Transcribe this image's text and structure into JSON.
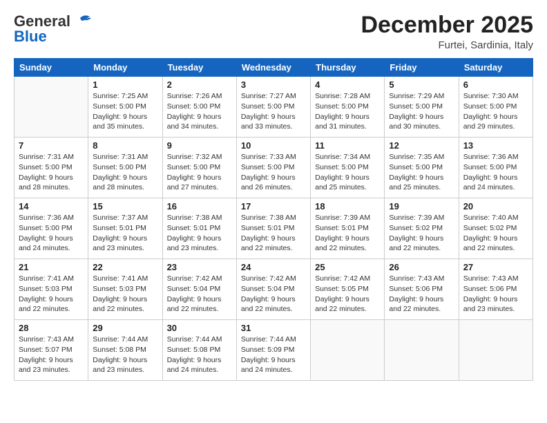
{
  "header": {
    "logo_general": "General",
    "logo_blue": "Blue",
    "month": "December 2025",
    "location": "Furtei, Sardinia, Italy"
  },
  "days_of_week": [
    "Sunday",
    "Monday",
    "Tuesday",
    "Wednesday",
    "Thursday",
    "Friday",
    "Saturday"
  ],
  "weeks": [
    [
      {
        "day": "",
        "sunrise": "",
        "sunset": "",
        "daylight": ""
      },
      {
        "day": "1",
        "sunrise": "7:25 AM",
        "sunset": "5:00 PM",
        "daylight": "9 hours and 35 minutes."
      },
      {
        "day": "2",
        "sunrise": "7:26 AM",
        "sunset": "5:00 PM",
        "daylight": "9 hours and 34 minutes."
      },
      {
        "day": "3",
        "sunrise": "7:27 AM",
        "sunset": "5:00 PM",
        "daylight": "9 hours and 33 minutes."
      },
      {
        "day": "4",
        "sunrise": "7:28 AM",
        "sunset": "5:00 PM",
        "daylight": "9 hours and 31 minutes."
      },
      {
        "day": "5",
        "sunrise": "7:29 AM",
        "sunset": "5:00 PM",
        "daylight": "9 hours and 30 minutes."
      },
      {
        "day": "6",
        "sunrise": "7:30 AM",
        "sunset": "5:00 PM",
        "daylight": "9 hours and 29 minutes."
      }
    ],
    [
      {
        "day": "7",
        "sunrise": "7:31 AM",
        "sunset": "5:00 PM",
        "daylight": "9 hours and 28 minutes."
      },
      {
        "day": "8",
        "sunrise": "7:31 AM",
        "sunset": "5:00 PM",
        "daylight": "9 hours and 28 minutes."
      },
      {
        "day": "9",
        "sunrise": "7:32 AM",
        "sunset": "5:00 PM",
        "daylight": "9 hours and 27 minutes."
      },
      {
        "day": "10",
        "sunrise": "7:33 AM",
        "sunset": "5:00 PM",
        "daylight": "9 hours and 26 minutes."
      },
      {
        "day": "11",
        "sunrise": "7:34 AM",
        "sunset": "5:00 PM",
        "daylight": "9 hours and 25 minutes."
      },
      {
        "day": "12",
        "sunrise": "7:35 AM",
        "sunset": "5:00 PM",
        "daylight": "9 hours and 25 minutes."
      },
      {
        "day": "13",
        "sunrise": "7:36 AM",
        "sunset": "5:00 PM",
        "daylight": "9 hours and 24 minutes."
      }
    ],
    [
      {
        "day": "14",
        "sunrise": "7:36 AM",
        "sunset": "5:00 PM",
        "daylight": "9 hours and 24 minutes."
      },
      {
        "day": "15",
        "sunrise": "7:37 AM",
        "sunset": "5:01 PM",
        "daylight": "9 hours and 23 minutes."
      },
      {
        "day": "16",
        "sunrise": "7:38 AM",
        "sunset": "5:01 PM",
        "daylight": "9 hours and 23 minutes."
      },
      {
        "day": "17",
        "sunrise": "7:38 AM",
        "sunset": "5:01 PM",
        "daylight": "9 hours and 22 minutes."
      },
      {
        "day": "18",
        "sunrise": "7:39 AM",
        "sunset": "5:01 PM",
        "daylight": "9 hours and 22 minutes."
      },
      {
        "day": "19",
        "sunrise": "7:39 AM",
        "sunset": "5:02 PM",
        "daylight": "9 hours and 22 minutes."
      },
      {
        "day": "20",
        "sunrise": "7:40 AM",
        "sunset": "5:02 PM",
        "daylight": "9 hours and 22 minutes."
      }
    ],
    [
      {
        "day": "21",
        "sunrise": "7:41 AM",
        "sunset": "5:03 PM",
        "daylight": "9 hours and 22 minutes."
      },
      {
        "day": "22",
        "sunrise": "7:41 AM",
        "sunset": "5:03 PM",
        "daylight": "9 hours and 22 minutes."
      },
      {
        "day": "23",
        "sunrise": "7:42 AM",
        "sunset": "5:04 PM",
        "daylight": "9 hours and 22 minutes."
      },
      {
        "day": "24",
        "sunrise": "7:42 AM",
        "sunset": "5:04 PM",
        "daylight": "9 hours and 22 minutes."
      },
      {
        "day": "25",
        "sunrise": "7:42 AM",
        "sunset": "5:05 PM",
        "daylight": "9 hours and 22 minutes."
      },
      {
        "day": "26",
        "sunrise": "7:43 AM",
        "sunset": "5:06 PM",
        "daylight": "9 hours and 22 minutes."
      },
      {
        "day": "27",
        "sunrise": "7:43 AM",
        "sunset": "5:06 PM",
        "daylight": "9 hours and 23 minutes."
      }
    ],
    [
      {
        "day": "28",
        "sunrise": "7:43 AM",
        "sunset": "5:07 PM",
        "daylight": "9 hours and 23 minutes."
      },
      {
        "day": "29",
        "sunrise": "7:44 AM",
        "sunset": "5:08 PM",
        "daylight": "9 hours and 23 minutes."
      },
      {
        "day": "30",
        "sunrise": "7:44 AM",
        "sunset": "5:08 PM",
        "daylight": "9 hours and 24 minutes."
      },
      {
        "day": "31",
        "sunrise": "7:44 AM",
        "sunset": "5:09 PM",
        "daylight": "9 hours and 24 minutes."
      },
      {
        "day": "",
        "sunrise": "",
        "sunset": "",
        "daylight": ""
      },
      {
        "day": "",
        "sunrise": "",
        "sunset": "",
        "daylight": ""
      },
      {
        "day": "",
        "sunrise": "",
        "sunset": "",
        "daylight": ""
      }
    ]
  ]
}
